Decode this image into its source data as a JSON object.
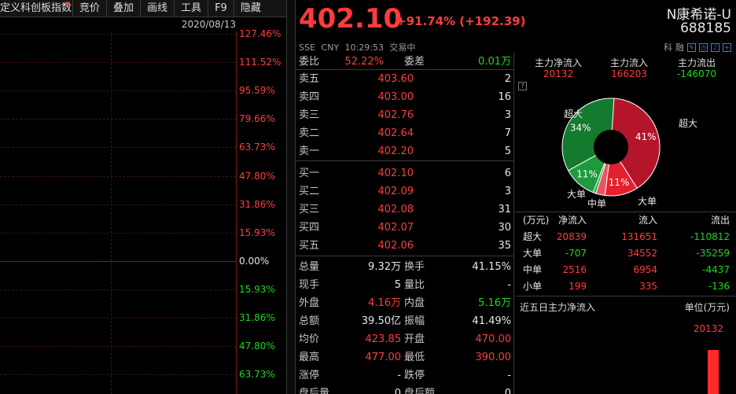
{
  "toolbar": {
    "items": [
      "定义科创板指数",
      "竞价",
      "叠加",
      "画线",
      "工具",
      "F9",
      "隐藏"
    ]
  },
  "chart": {
    "date": "2020/08/13",
    "pct_labels": [
      {
        "text": "127.46%",
        "color": "red"
      },
      {
        "text": "111.52%",
        "color": "red"
      },
      {
        "text": "95.59%",
        "color": "red"
      },
      {
        "text": "79.66%",
        "color": "red"
      },
      {
        "text": "63.73%",
        "color": "red"
      },
      {
        "text": "47.80%",
        "color": "red"
      },
      {
        "text": "31.86%",
        "color": "red"
      },
      {
        "text": "15.93%",
        "color": "red"
      },
      {
        "text": "0.00%",
        "color": "white"
      },
      {
        "text": "15.93%",
        "color": "green"
      },
      {
        "text": "31.86%",
        "color": "green"
      },
      {
        "text": "47.80%",
        "color": "green"
      },
      {
        "text": "63.73%",
        "color": "green"
      }
    ]
  },
  "quote": {
    "price": "402.10",
    "change": "+91.74% (+192.39)",
    "meta": "SSE CNY 10:29:53 交易中",
    "name": "N康希诺-U",
    "code": "688185",
    "tag1": "科",
    "tag2": "融"
  },
  "order_book": {
    "ratio_label": "委比",
    "ratio_value": "52.22%",
    "diff_label": "委差",
    "diff_value": "0.01万",
    "asks": [
      {
        "label": "卖五",
        "price": "403.60",
        "vol": "2"
      },
      {
        "label": "卖四",
        "price": "403.00",
        "vol": "16"
      },
      {
        "label": "卖三",
        "price": "402.76",
        "vol": "3"
      },
      {
        "label": "卖二",
        "price": "402.64",
        "vol": "7"
      },
      {
        "label": "卖一",
        "price": "402.20",
        "vol": "5"
      }
    ],
    "bids": [
      {
        "label": "买一",
        "price": "402.10",
        "vol": "6"
      },
      {
        "label": "买二",
        "price": "402.09",
        "vol": "3"
      },
      {
        "label": "买三",
        "price": "402.08",
        "vol": "31"
      },
      {
        "label": "买四",
        "price": "402.07",
        "vol": "30"
      },
      {
        "label": "买五",
        "price": "402.06",
        "vol": "35"
      }
    ]
  },
  "stats": [
    {
      "k1": "总量",
      "v1": "9.32万",
      "c1": "white",
      "k2": "换手",
      "v2": "41.15%",
      "c2": "white"
    },
    {
      "k1": "现手",
      "v1": "5",
      "c1": "white",
      "k2": "量比",
      "v2": "-",
      "c2": "white"
    },
    {
      "k1": "外盘",
      "v1": "4.16万",
      "c1": "red",
      "k2": "内盘",
      "v2": "5.16万",
      "c2": "green"
    },
    {
      "k1": "总额",
      "v1": "39.50亿",
      "c1": "white",
      "k2": "振幅",
      "v2": "41.49%",
      "c2": "white"
    },
    {
      "k1": "均价",
      "v1": "423.85",
      "c1": "red",
      "k2": "开盘",
      "v2": "470.00",
      "c2": "red"
    },
    {
      "k1": "最高",
      "v1": "477.00",
      "c1": "red",
      "k2": "最低",
      "v2": "390.00",
      "c2": "red"
    },
    {
      "k1": "涨停",
      "v1": "-",
      "c1": "white",
      "k2": "跌停",
      "v2": "-",
      "c2": "white"
    },
    {
      "k1": "盘后量",
      "v1": "0",
      "c1": "white",
      "k2": "盘后额",
      "v2": "0",
      "c2": "white"
    }
  ],
  "flow": {
    "headers": [
      "主力净流入",
      "主力流入",
      "主力流出"
    ],
    "values": [
      "20132",
      "166203",
      "-146070"
    ],
    "help": "?",
    "pie": {
      "slices": [
        {
          "name": "超大",
          "pct": 41,
          "label": "41%",
          "color": "#b5152a"
        },
        {
          "name": "大单",
          "pct": 11,
          "label": "11%",
          "color": "#e4202e"
        },
        {
          "name": "中单",
          "pct": 3,
          "label": "",
          "color": "#e85560"
        },
        {
          "name": "中单",
          "pct": 1,
          "label": "",
          "color": "#2fa84a"
        },
        {
          "name": "大单",
          "pct": 11,
          "label": "11%",
          "color": "#1e9a3c"
        },
        {
          "name": "超大",
          "pct": 34,
          "label": "34%",
          "color": "#137a2e"
        }
      ],
      "outer_labels": [
        "超大",
        "大单",
        "中单",
        "大单",
        "超大"
      ]
    },
    "table_header": [
      "(万元)",
      "流入",
      "净流入",
      "流出"
    ],
    "table": [
      {
        "type": "超大",
        "net": "20839",
        "in": "131651",
        "out": "-110812",
        "nc": "red",
        "oc": "green"
      },
      {
        "type": "大单",
        "net": "-707",
        "in": "34552",
        "out": "-35259",
        "nc": "green",
        "oc": "green"
      },
      {
        "type": "中单",
        "net": "2516",
        "in": "6954",
        "out": "-4437",
        "nc": "red",
        "oc": "green"
      },
      {
        "type": "小单",
        "net": "199",
        "in": "335",
        "out": "-136",
        "nc": "red",
        "oc": "green"
      }
    ],
    "five_day_title": "近五日主力净流入",
    "five_day_unit": "单位(万元)",
    "five_day_value": "20132",
    "five_day_fill": 0.72
  }
}
